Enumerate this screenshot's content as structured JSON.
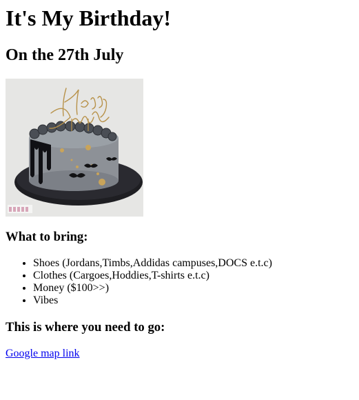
{
  "page": {
    "title": "It's My Birthday!",
    "subtitle": "On the 27th July"
  },
  "cake_image": {
    "topper_text": "Happy Birthday",
    "watermark": "BIRTHDAY CAKE"
  },
  "bring": {
    "heading": "What to bring:",
    "items": [
      "Shoes (Jordans,Timbs,Addidas campuses,DOCS e.t.c)",
      "Clothes (Cargoes,Hoddies,T-shirts e.t.c)",
      "Money ($100>>)",
      "Vibes"
    ]
  },
  "location": {
    "heading": "This is where you need to go:",
    "link_text": "Google map link"
  },
  "colors": {
    "link": "#0000ee",
    "text": "#000000",
    "background": "#ffffff"
  }
}
